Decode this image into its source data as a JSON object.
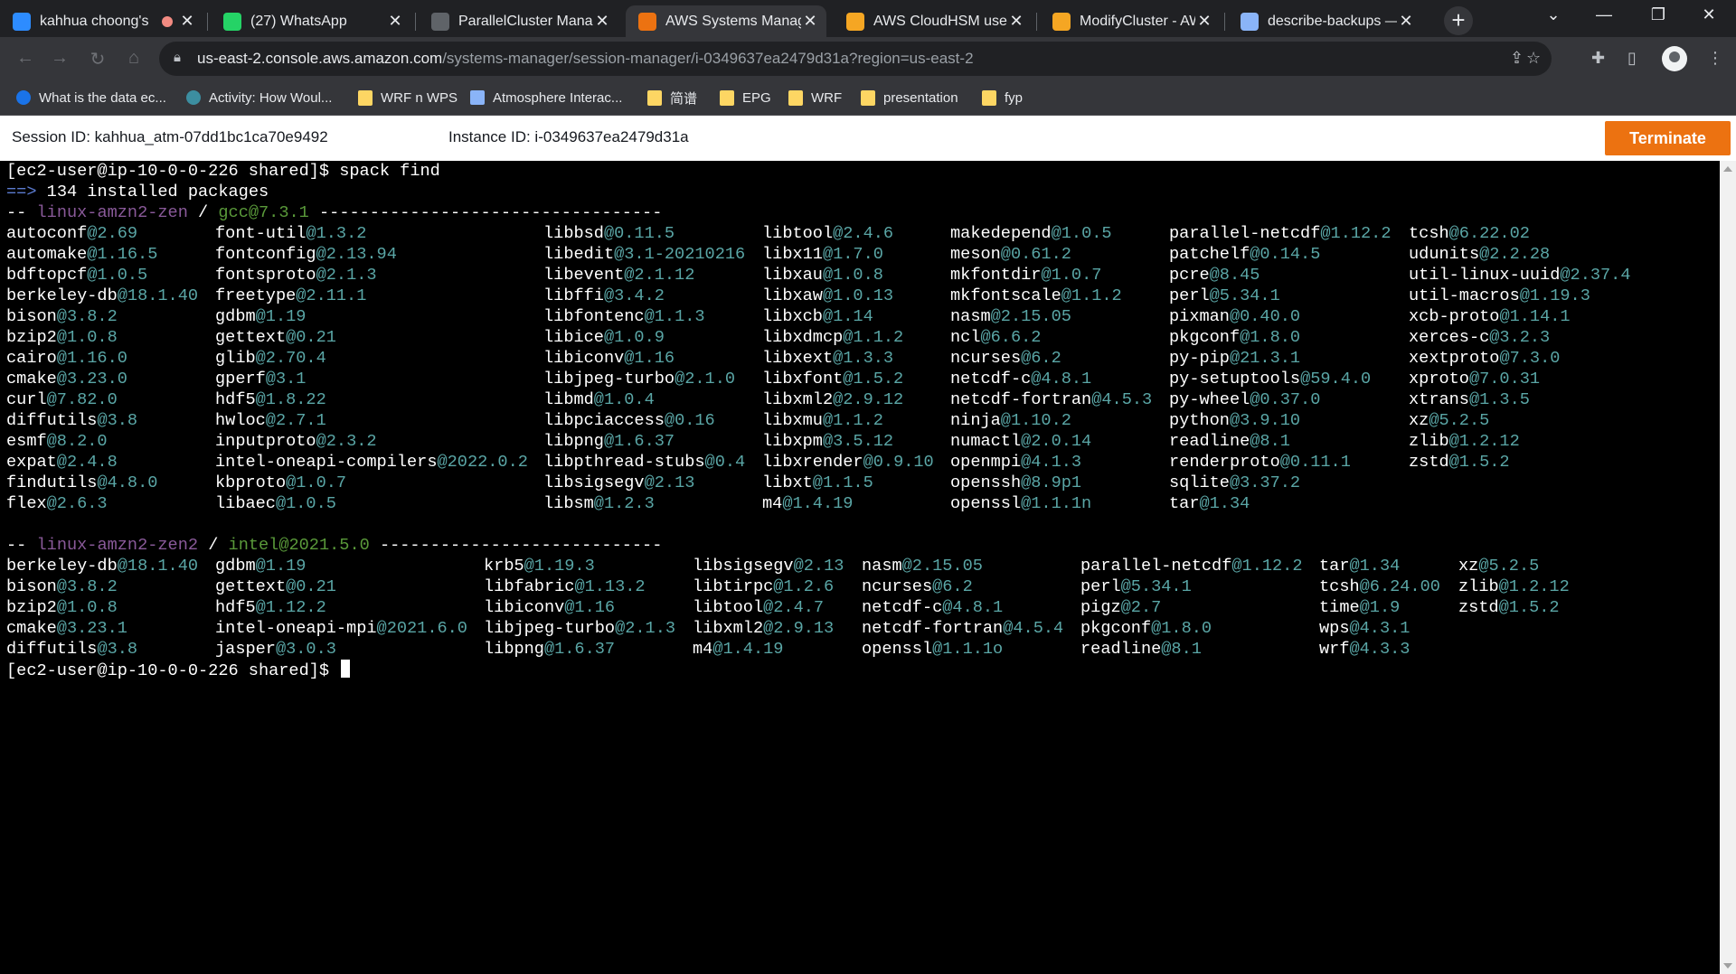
{
  "browser": {
    "tabs": [
      {
        "title": "kahhua choong's",
        "icon": "zoom-icon",
        "color": "#2d8cff",
        "recording": true
      },
      {
        "title": "(27) WhatsApp",
        "icon": "whatsapp-icon",
        "color": "#25d366"
      },
      {
        "title": "ParallelCluster Manag",
        "icon": "github-icon",
        "color": "#5f6368"
      },
      {
        "title": "AWS Systems Manage",
        "icon": "aws-icon",
        "color": "#ec7211",
        "active": true
      },
      {
        "title": "AWS CloudHSM use c",
        "icon": "aws-docs-icon",
        "color": "#f5a623"
      },
      {
        "title": "ModifyCluster - AWS",
        "icon": "aws-docs-icon",
        "color": "#f5a623"
      },
      {
        "title": "describe-backups — A",
        "icon": "globe-icon",
        "color": "#8ab4f8"
      }
    ],
    "new_tab": "+",
    "url_host": "us-east-2.console.aws.amazon.com",
    "url_path": "/systems-manager/session-manager/i-0349637ea2479d31a?region=us-east-2",
    "bookmarks": [
      {
        "label": "What is the data ec...",
        "icon": "c-icon"
      },
      {
        "label": "Activity: How Woul...",
        "icon": "activity-icon"
      },
      {
        "label": "WRF n WPS",
        "icon": "folder-icon"
      },
      {
        "label": "Atmosphere Interac...",
        "icon": "atmos-icon"
      },
      {
        "label": "简谱",
        "icon": "folder-icon"
      },
      {
        "label": "EPG",
        "icon": "folder-icon"
      },
      {
        "label": "WRF",
        "icon": "folder-icon"
      },
      {
        "label": "presentation",
        "icon": "folder-icon"
      },
      {
        "label": "fyp",
        "icon": "folder-icon"
      }
    ]
  },
  "session": {
    "session_label": "Session ID: kahhua_atm-07dd1bc1ca70e9492",
    "instance_label": "Instance ID: i-0349637ea2479d31a",
    "terminate_label": "Terminate"
  },
  "terminal": {
    "prompt": "[ec2-user@ip-10-0-0-226 shared]$",
    "command": "spack find",
    "arrow": "==>",
    "summary": "134 installed packages",
    "sections": [
      {
        "prefix": "--",
        "arch": "linux-amzn2-zen",
        "sep": "/",
        "compiler": "gcc@7.3.1",
        "dashes": "----------------------------------",
        "columns": [
          [
            [
              "autoconf",
              "@2.69"
            ],
            [
              "automake",
              "@1.16.5"
            ],
            [
              "bdftopcf",
              "@1.0.5"
            ],
            [
              "berkeley-db",
              "@18.1.40"
            ],
            [
              "bison",
              "@3.8.2"
            ],
            [
              "bzip2",
              "@1.0.8"
            ],
            [
              "cairo",
              "@1.16.0"
            ],
            [
              "cmake",
              "@3.23.0"
            ],
            [
              "curl",
              "@7.82.0"
            ],
            [
              "diffutils",
              "@3.8"
            ],
            [
              "esmf",
              "@8.2.0"
            ],
            [
              "expat",
              "@2.4.8"
            ],
            [
              "findutils",
              "@4.8.0"
            ],
            [
              "flex",
              "@2.6.3"
            ]
          ],
          [
            [
              "font-util",
              "@1.3.2"
            ],
            [
              "fontconfig",
              "@2.13.94"
            ],
            [
              "fontsproto",
              "@2.1.3"
            ],
            [
              "freetype",
              "@2.11.1"
            ],
            [
              "gdbm",
              "@1.19"
            ],
            [
              "gettext",
              "@0.21"
            ],
            [
              "glib",
              "@2.70.4"
            ],
            [
              "gperf",
              "@3.1"
            ],
            [
              "hdf5",
              "@1.8.22"
            ],
            [
              "hwloc",
              "@2.7.1"
            ],
            [
              "inputproto",
              "@2.3.2"
            ],
            [
              "intel-oneapi-compilers",
              "@2022.0.2"
            ],
            [
              "kbproto",
              "@1.0.7"
            ],
            [
              "libaec",
              "@1.0.5"
            ]
          ],
          [
            [
              "libbsd",
              "@0.11.5"
            ],
            [
              "libedit",
              "@3.1-20210216"
            ],
            [
              "libevent",
              "@2.1.12"
            ],
            [
              "libffi",
              "@3.4.2"
            ],
            [
              "libfontenc",
              "@1.1.3"
            ],
            [
              "libice",
              "@1.0.9"
            ],
            [
              "libiconv",
              "@1.16"
            ],
            [
              "libjpeg-turbo",
              "@2.1.0"
            ],
            [
              "libmd",
              "@1.0.4"
            ],
            [
              "libpciaccess",
              "@0.16"
            ],
            [
              "libpng",
              "@1.6.37"
            ],
            [
              "libpthread-stubs",
              "@0.4"
            ],
            [
              "libsigsegv",
              "@2.13"
            ],
            [
              "libsm",
              "@1.2.3"
            ]
          ],
          [
            [
              "libtool",
              "@2.4.6"
            ],
            [
              "libx11",
              "@1.7.0"
            ],
            [
              "libxau",
              "@1.0.8"
            ],
            [
              "libxaw",
              "@1.0.13"
            ],
            [
              "libxcb",
              "@1.14"
            ],
            [
              "libxdmcp",
              "@1.1.2"
            ],
            [
              "libxext",
              "@1.3.3"
            ],
            [
              "libxfont",
              "@1.5.2"
            ],
            [
              "libxml2",
              "@2.9.12"
            ],
            [
              "libxmu",
              "@1.1.2"
            ],
            [
              "libxpm",
              "@3.5.12"
            ],
            [
              "libxrender",
              "@0.9.10"
            ],
            [
              "libxt",
              "@1.1.5"
            ],
            [
              "m4",
              "@1.4.19"
            ]
          ],
          [
            [
              "makedepend",
              "@1.0.5"
            ],
            [
              "meson",
              "@0.61.2"
            ],
            [
              "mkfontdir",
              "@1.0.7"
            ],
            [
              "mkfontscale",
              "@1.1.2"
            ],
            [
              "nasm",
              "@2.15.05"
            ],
            [
              "ncl",
              "@6.6.2"
            ],
            [
              "ncurses",
              "@6.2"
            ],
            [
              "netcdf-c",
              "@4.8.1"
            ],
            [
              "netcdf-fortran",
              "@4.5.3"
            ],
            [
              "ninja",
              "@1.10.2"
            ],
            [
              "numactl",
              "@2.0.14"
            ],
            [
              "openmpi",
              "@4.1.3"
            ],
            [
              "openssh",
              "@8.9p1"
            ],
            [
              "openssl",
              "@1.1.1n"
            ]
          ],
          [
            [
              "parallel-netcdf",
              "@1.12.2"
            ],
            [
              "patchelf",
              "@0.14.5"
            ],
            [
              "pcre",
              "@8.45"
            ],
            [
              "perl",
              "@5.34.1"
            ],
            [
              "pixman",
              "@0.40.0"
            ],
            [
              "pkgconf",
              "@1.8.0"
            ],
            [
              "py-pip",
              "@21.3.1"
            ],
            [
              "py-setuptools",
              "@59.4.0"
            ],
            [
              "py-wheel",
              "@0.37.0"
            ],
            [
              "python",
              "@3.9.10"
            ],
            [
              "readline",
              "@8.1"
            ],
            [
              "renderproto",
              "@0.11.1"
            ],
            [
              "sqlite",
              "@3.37.2"
            ],
            [
              "tar",
              "@1.34"
            ]
          ],
          [
            [
              "tcsh",
              "@6.22.02"
            ],
            [
              "udunits",
              "@2.2.28"
            ],
            [
              "util-linux-uuid",
              "@2.37.4"
            ],
            [
              "util-macros",
              "@1.19.3"
            ],
            [
              "xcb-proto",
              "@1.14.1"
            ],
            [
              "xerces-c",
              "@3.2.3"
            ],
            [
              "xextproto",
              "@7.3.0"
            ],
            [
              "xproto",
              "@7.0.31"
            ],
            [
              "xtrans",
              "@1.3.5"
            ],
            [
              "xz",
              "@5.2.5"
            ],
            [
              "zlib",
              "@1.2.12"
            ],
            [
              "zstd",
              "@1.5.2"
            ]
          ]
        ]
      },
      {
        "prefix": "--",
        "arch": "linux-amzn2-zen2",
        "sep": "/",
        "compiler": "intel@2021.5.0",
        "dashes": "----------------------------",
        "columns": [
          [
            [
              "berkeley-db",
              "@18.1.40"
            ],
            [
              "bison",
              "@3.8.2"
            ],
            [
              "bzip2",
              "@1.0.8"
            ],
            [
              "cmake",
              "@3.23.1"
            ],
            [
              "diffutils",
              "@3.8"
            ]
          ],
          [
            [
              "gdbm",
              "@1.19"
            ],
            [
              "gettext",
              "@0.21"
            ],
            [
              "hdf5",
              "@1.12.2"
            ],
            [
              "intel-oneapi-mpi",
              "@2021.6.0"
            ],
            [
              "jasper",
              "@3.0.3"
            ]
          ],
          [
            [
              "krb5",
              "@1.19.3"
            ],
            [
              "libfabric",
              "@1.13.2"
            ],
            [
              "libiconv",
              "@1.16"
            ],
            [
              "libjpeg-turbo",
              "@2.1.3"
            ],
            [
              "libpng",
              "@1.6.37"
            ]
          ],
          [
            [
              "libsigsegv",
              "@2.13"
            ],
            [
              "libtirpc",
              "@1.2.6"
            ],
            [
              "libtool",
              "@2.4.7"
            ],
            [
              "libxml2",
              "@2.9.13"
            ],
            [
              "m4",
              "@1.4.19"
            ]
          ],
          [
            [
              "nasm",
              "@2.15.05"
            ],
            [
              "ncurses",
              "@6.2"
            ],
            [
              "netcdf-c",
              "@4.8.1"
            ],
            [
              "netcdf-fortran",
              "@4.5.4"
            ],
            [
              "openssl",
              "@1.1.1o"
            ]
          ],
          [
            [
              "parallel-netcdf",
              "@1.12.2"
            ],
            [
              "perl",
              "@5.34.1"
            ],
            [
              "pigz",
              "@2.7"
            ],
            [
              "pkgconf",
              "@1.8.0"
            ],
            [
              "readline",
              "@8.1"
            ]
          ],
          [
            [
              "tar",
              "@1.34"
            ],
            [
              "tcsh",
              "@6.24.00"
            ],
            [
              "time",
              "@1.9"
            ],
            [
              "wps",
              "@4.3.1"
            ],
            [
              "wrf",
              "@4.3.3"
            ]
          ],
          [
            [
              "xz",
              "@5.2.5"
            ],
            [
              "zlib",
              "@1.2.12"
            ],
            [
              "zstd",
              "@1.5.2"
            ]
          ]
        ]
      }
    ]
  }
}
